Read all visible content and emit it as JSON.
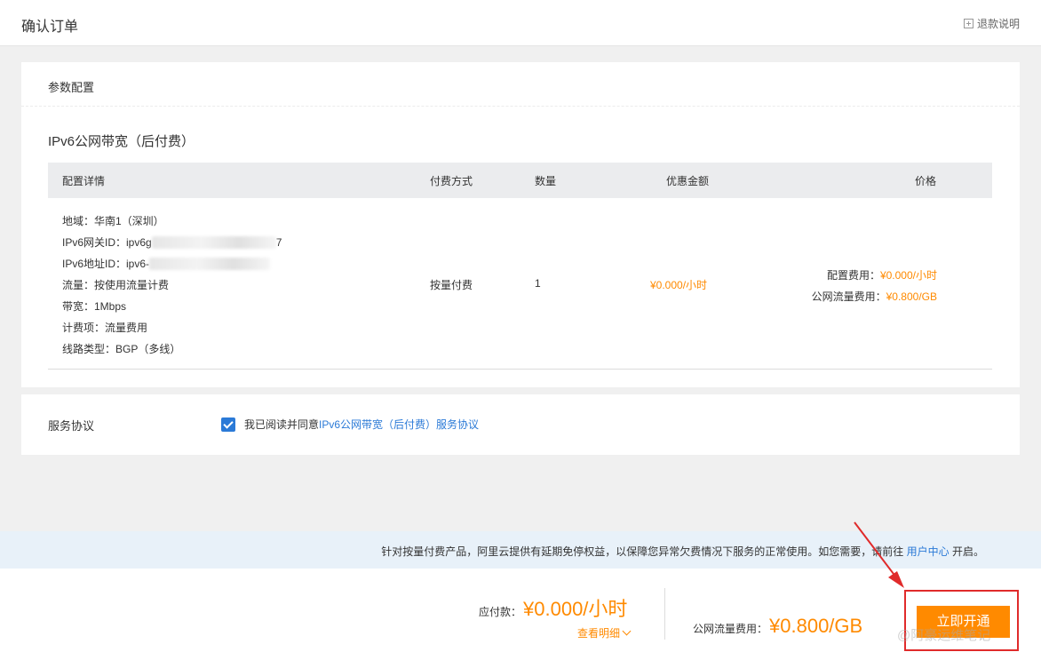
{
  "header": {
    "title": "确认订单",
    "refund_link": "退款说明"
  },
  "config_section": {
    "title": "参数配置",
    "product_name": "IPv6公网带宽（后付费）",
    "table": {
      "headers": {
        "details": "配置详情",
        "payment": "付费方式",
        "quantity": "数量",
        "discount": "优惠金额",
        "price": "价格"
      },
      "details": {
        "region": "地域：华南1（深圳）",
        "gateway_prefix": "IPv6网关ID：ipv6g",
        "gateway_suffix": "7",
        "address_prefix": "IPv6地址ID：ipv6-",
        "traffic": "流量：按使用流量计费",
        "bandwidth": "带宽：1Mbps",
        "billing_item": "计费项：流量费用",
        "line_type": "线路类型：BGP（多线）"
      },
      "payment": "按量付费",
      "quantity": "1",
      "discount": "¥0.000/小时",
      "price": {
        "config_label": "配置费用：",
        "config_value": "¥0.000/小时",
        "traffic_label": "公网流量费用：",
        "traffic_value": "¥0.800/GB"
      }
    }
  },
  "agreement": {
    "label": "服务协议",
    "checked": true,
    "text": "我已阅读并同意",
    "link": "IPv6公网带宽（后付费）服务协议"
  },
  "notice": {
    "text": "针对按量付费产品，阿里云提供有延期免停权益，以保障您异常欠费情况下服务的正常使用。如您需要，请前往",
    "link": "用户中心",
    "suffix": "开启。"
  },
  "footer": {
    "due_label": "应付款：",
    "due_amount": "¥0.000/小时",
    "view_detail": "查看明细",
    "traffic_label": "公网流量费用：",
    "traffic_amount": "¥0.800/GB",
    "buy_button": "立即开通",
    "watermark": "@阿豪运维笔记"
  },
  "colors": {
    "accent": "#ff8a00",
    "link": "#2b7ad7",
    "highlight_box": "#e02b2b"
  }
}
